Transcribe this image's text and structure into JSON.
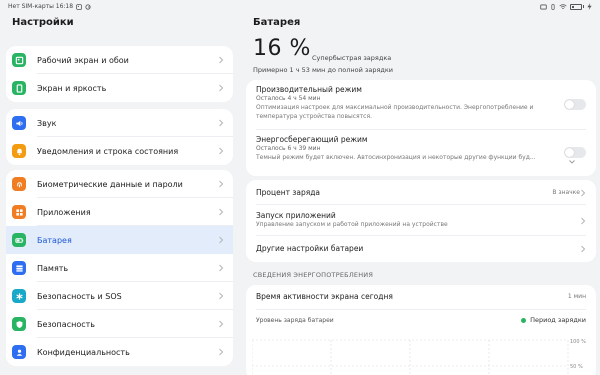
{
  "statusbar": {
    "left_text": "Нет SIM-карты 16:18",
    "battery_level": 0.16
  },
  "left": {
    "title": "Настройки",
    "groups": [
      {
        "items": [
          {
            "label": "Рабочий экран и обои",
            "icon": "wallpaper-icon",
            "color": "#28b463"
          },
          {
            "label": "Экран и яркость",
            "icon": "display-icon",
            "color": "#28b463"
          }
        ]
      },
      {
        "items": [
          {
            "label": "Звук",
            "icon": "sound-icon",
            "color": "#2e6ef0"
          },
          {
            "label": "Уведомления и строка состояния",
            "icon": "notification-icon",
            "color": "#f39c12"
          }
        ]
      },
      {
        "items": [
          {
            "label": "Биометрические данные и пароли",
            "icon": "fingerprint-icon",
            "color": "#f07d22"
          },
          {
            "label": "Приложения",
            "icon": "apps-icon",
            "color": "#f07d22"
          },
          {
            "label": "Батарея",
            "icon": "battery-icon",
            "color": "#28b463",
            "active": true
          },
          {
            "label": "Память",
            "icon": "storage-icon",
            "color": "#2e6ef0"
          },
          {
            "label": "Безопасность и SOS",
            "icon": "sos-icon",
            "color": "#1aa8c8"
          },
          {
            "label": "Безопасность",
            "icon": "security-icon",
            "color": "#28b463"
          },
          {
            "label": "Конфиденциальность",
            "icon": "privacy-icon",
            "color": "#2e6ef0"
          }
        ]
      }
    ]
  },
  "right": {
    "title": "Батарея",
    "percent": "16 %",
    "charge_mode": "Супербыстрая зарядка",
    "charge_eta": "Примерно 1 ч 53 мин до полной зарядки",
    "modes": [
      {
        "title": "Производительный режим",
        "subtitle": "Осталось 4 ч 54 мин",
        "description": "Оптимизация настроек для максимальной производительности. Энергопотребление и температура устройства повысятся."
      },
      {
        "title": "Энергосберегающий режим",
        "subtitle": "Осталось 6 ч 39 мин",
        "description": "Темный режим будет включен. Автосинхронизация и некоторые другие функции буд..."
      }
    ],
    "settings": [
      {
        "title": "Процент заряда",
        "value": "В значке"
      },
      {
        "title": "Запуск приложений",
        "subtitle": "Управление запуском и работой приложений на устройстве"
      },
      {
        "title": "Другие настройки батареи"
      }
    ],
    "section_header": "СВЕДЕНИЯ ЭНЕРГОПОТРЕБЛЕНИЯ",
    "screen_time": {
      "title": "Время активности экрана сегодня",
      "value": "1 мин"
    },
    "battery_level_label": "Уровень заряда батареи",
    "legend_label": "Период зарядки",
    "legend_color": "#28b463",
    "chart_ticks": [
      "100 %",
      "50 %"
    ]
  }
}
